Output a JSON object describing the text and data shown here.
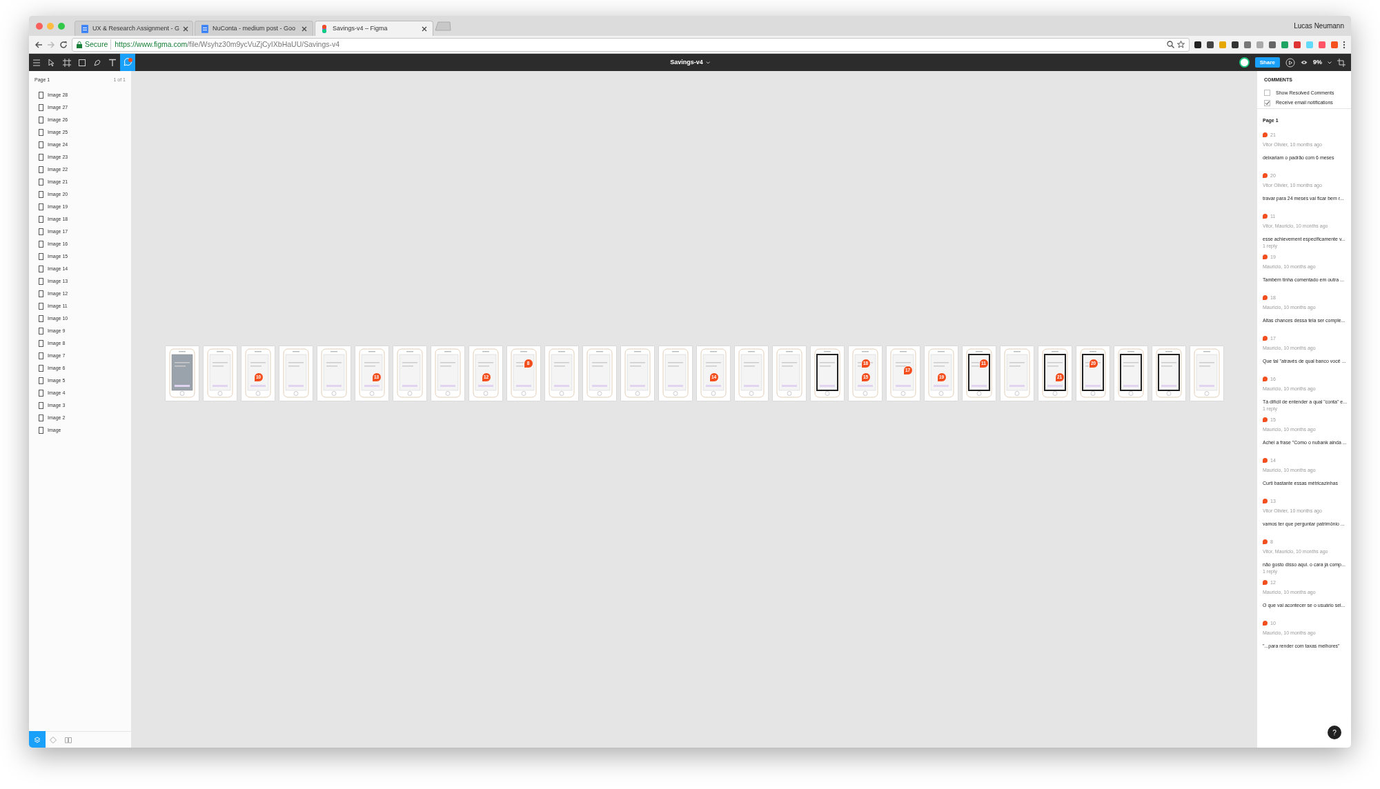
{
  "browser": {
    "tabs": [
      {
        "title": "UX & Research Assignment - G",
        "selected": false
      },
      {
        "title": "NuConta - medium post - Goo",
        "selected": false
      },
      {
        "title": "Savings-v4 – Figma",
        "selected": true
      }
    ],
    "profile_name": "Lucas Neumann",
    "secure_label": "Secure",
    "url_host": "https://www.figma.com",
    "url_path": "/file/Wsyhz30m9ycVuZjCyIXbHaUU/Savings-v4"
  },
  "toolbar": {
    "file_title": "Savings-v4",
    "share": "Share",
    "zoom": "9%",
    "comment_tool_selected": true
  },
  "layers": {
    "page": "Page 1",
    "page_count": "1 of 1",
    "items": [
      "Image 28",
      "Image 27",
      "Image 26",
      "Image 25",
      "Image 24",
      "Image 23",
      "Image 22",
      "Image 21",
      "Image 20",
      "Image 19",
      "Image 18",
      "Image 17",
      "Image 16",
      "Image 15",
      "Image 14",
      "Image 13",
      "Image 12",
      "Image 11",
      "Image 10",
      "Image 9",
      "Image 8",
      "Image 7",
      "Image 6",
      "Image 5",
      "Image 4",
      "Image 3",
      "Image 2",
      "Image"
    ]
  },
  "canvas": {
    "frames": [
      {
        "kind": "photo"
      },
      {
        "kind": "light"
      },
      {
        "kind": "light",
        "pins": [
          "10"
        ]
      },
      {
        "kind": "light"
      },
      {
        "kind": "light"
      },
      {
        "kind": "light",
        "pins": [
          "13"
        ]
      },
      {
        "kind": "light"
      },
      {
        "kind": "light"
      },
      {
        "kind": "light",
        "pins": [
          "12"
        ]
      },
      {
        "kind": "light",
        "pins": [
          "8"
        ]
      },
      {
        "kind": "light"
      },
      {
        "kind": "light"
      },
      {
        "kind": "light"
      },
      {
        "kind": "light"
      },
      {
        "kind": "light",
        "pins": [
          "14"
        ]
      },
      {
        "kind": "light"
      },
      {
        "kind": "light"
      },
      {
        "kind": "dark"
      },
      {
        "kind": "light",
        "pins": [
          "18",
          "15"
        ]
      },
      {
        "kind": "light",
        "pins": [
          "17"
        ]
      },
      {
        "kind": "light",
        "pins": [
          "19"
        ]
      },
      {
        "kind": "dark",
        "pins": [
          "11"
        ]
      },
      {
        "kind": "light"
      },
      {
        "kind": "dark",
        "pins": [
          "21"
        ]
      },
      {
        "kind": "dark",
        "pins": [
          "20"
        ]
      },
      {
        "kind": "dark"
      },
      {
        "kind": "dark"
      },
      {
        "kind": "light"
      }
    ]
  },
  "comments": {
    "heading": "COMMENTS",
    "options": [
      {
        "label": "Show Resolved Comments",
        "checked": false
      },
      {
        "label": "Receive email notifications",
        "checked": true
      }
    ],
    "page": "Page 1",
    "items": [
      {
        "number": "21",
        "byline": "Vitor Olivier, 10 months ago",
        "text": "deixariam o padrão com 6 meses"
      },
      {
        "number": "20",
        "byline": "Vitor Olivier, 10 months ago",
        "text": "travar para 24 meses vai ficar bem r..."
      },
      {
        "number": "11",
        "byline": "Vitor, Mauricio, 10 months ago",
        "text": "esse achievement especificamente v...",
        "replies": "1 reply"
      },
      {
        "number": "19",
        "byline": "Mauricio, 10 months ago",
        "text": "Também tinha comentado em outra ..."
      },
      {
        "number": "18",
        "byline": "Mauricio, 10 months ago",
        "text": "Altas chances dessa tela ser comple..."
      },
      {
        "number": "17",
        "byline": "Mauricio, 10 months ago",
        "text": "Que tal \"através de qual banco você ..."
      },
      {
        "number": "16",
        "byline": "Mauricio, 10 months ago",
        "text": "Tá difícil de entender a qual \"conta\" e...",
        "replies": "1 reply"
      },
      {
        "number": "15",
        "byline": "Mauricio, 10 months ago",
        "text": "Achei a frase \"Como o nubank ainda ..."
      },
      {
        "number": "14",
        "byline": "Mauricio, 10 months ago",
        "text": "Curti bastante essas métricazinhas"
      },
      {
        "number": "13",
        "byline": "Vitor Olivier, 10 months ago",
        "text": "vamos ter que perguntar patrimônio ..."
      },
      {
        "number": "8",
        "byline": "Vitor, Mauricio, 10 months ago",
        "text": "não gosto disso aqui. o cara já comp...",
        "replies": "1 reply"
      },
      {
        "number": "12",
        "byline": "Mauricio, 10 months ago",
        "text": "O que vai acontecer se o usuário sel..."
      },
      {
        "number": "10",
        "byline": "Mauricio, 10 months ago",
        "text": "\"...para render com taxas melhores\""
      }
    ]
  },
  "help": "?"
}
